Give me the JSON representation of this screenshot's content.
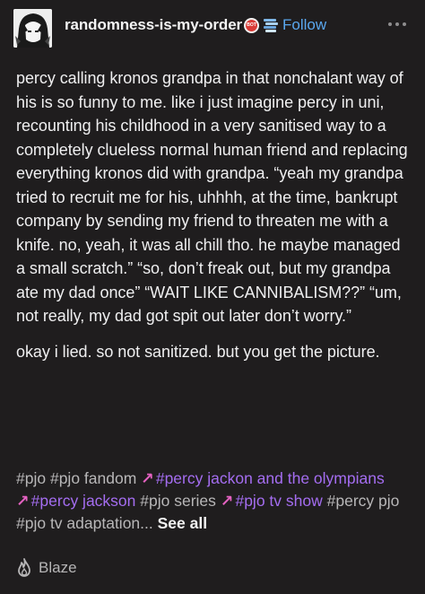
{
  "header": {
    "username": "randomness-is-my-order",
    "badge1_text": "BOT",
    "follow_label": "Follow"
  },
  "post": {
    "paragraphs": [
      "percy calling kronos grandpa in that nonchalant way of his is so funny to me. like i just imagine percy in uni, recounting his childhood in a very sanitised way to a completely clueless normal human friend and replacing everything kronos did with grandpa. “yeah my grandpa tried to recruit me for his, uhhhh, at the time, bankrupt company by sending my friend to threaten me with a knife. no, yeah, it was all chill tho. he maybe managed a small scratch.” “so, don’t freak out, but my grandpa ate my dad once” “WAIT LIKE CANNIBALISM??” “um, not really, my dad got spit out later don’t worry.”",
      "okay i lied. so not sanitized. but you get the picture."
    ]
  },
  "tags": {
    "items": [
      {
        "text": "#pjo",
        "trending": false
      },
      {
        "text": "#pjo fandom",
        "trending": false
      },
      {
        "text": "#percy jackon and the olympians",
        "trending": true
      },
      {
        "text": "#percy jackson",
        "trending": true
      },
      {
        "text": "#pjo series",
        "trending": false
      },
      {
        "text": "#pjo tv show",
        "trending": true
      },
      {
        "text": "#percy pjo",
        "trending": false
      },
      {
        "text": "#pjo tv adaptation...",
        "trending": false
      }
    ],
    "see_all_label": "See all"
  },
  "footer": {
    "blaze_label": "Blaze"
  },
  "colors": {
    "background": "#1f1d1e",
    "follow": "#5aa7ee",
    "trending_tag": "#a46df0",
    "trending_arrow": "#e562c2"
  }
}
